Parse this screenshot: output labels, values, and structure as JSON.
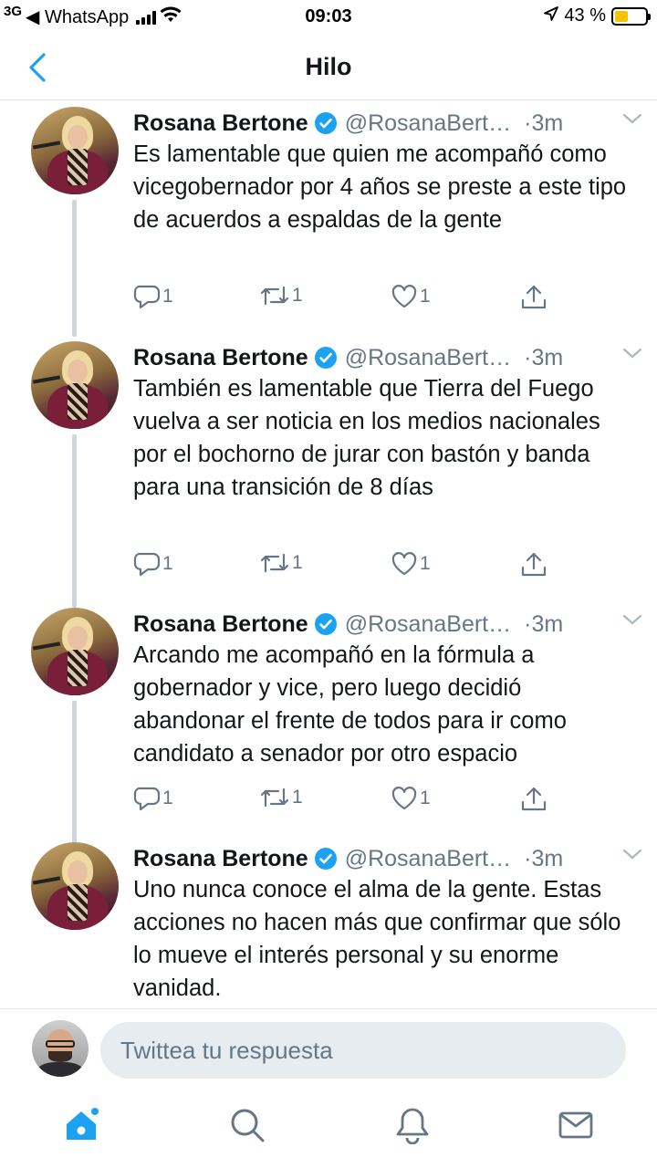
{
  "status_bar": {
    "network": "3G",
    "back_to_app": "◀ WhatsApp",
    "time": "09:03",
    "battery_percent": "43 %",
    "battery_level": 0.43
  },
  "header": {
    "title": "Hilo"
  },
  "tweets": [
    {
      "author": "Rosana Bertone",
      "handle": "@RosanaBert…",
      "time": "·3m",
      "text": "Es lamentable que quien me acompañó como vicegobernador por 4 años se preste a este tipo de acuerdos a espaldas de la gente",
      "replies": "1",
      "retweets": "1",
      "likes": "1"
    },
    {
      "author": "Rosana Bertone",
      "handle": "@RosanaBert…",
      "time": "·3m",
      "text": "También es lamentable que Tierra del Fuego vuelva a ser noticia en los medios nacionales por el bochorno de jurar con bastón y banda para una transición de 8 días",
      "replies": "1",
      "retweets": "1",
      "likes": "1"
    },
    {
      "author": "Rosana Bertone",
      "handle": "@RosanaBert…",
      "time": "·3m",
      "text": "Arcando me acompañó en la fórmula a gobernador y vice, pero luego decidió abandonar el frente de todos para ir como candidato a senador por otro espacio",
      "replies": "1",
      "retweets": "1",
      "likes": "1"
    },
    {
      "author": "Rosana Bertone",
      "handle": "@RosanaBert…",
      "time": "·3m",
      "text": "Uno nunca conoce el alma de la gente. Estas acciones no hacen más que confirmar que sólo lo mueve el interés personal y su enorme vanidad."
    }
  ],
  "reply": {
    "placeholder": "Twittea tu respuesta"
  },
  "tabs": [
    "home-icon",
    "search-icon",
    "notifications-icon",
    "messages-icon"
  ],
  "colors": {
    "accent": "#1da1f2",
    "secondary_text": "#657786",
    "thread_line": "#ccd6dd",
    "battery": "#f5c400"
  }
}
